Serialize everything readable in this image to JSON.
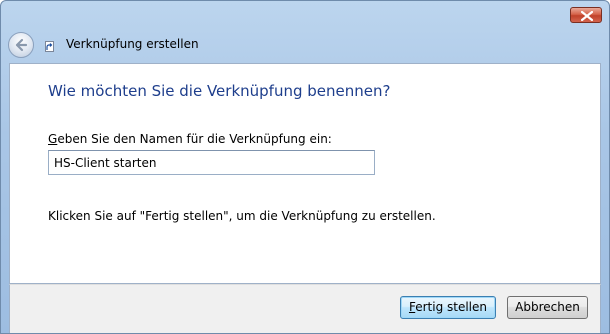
{
  "window": {
    "close_icon": "close-icon"
  },
  "nav": {
    "back_icon": "back-arrow-icon",
    "shortcut_icon": "shortcut-icon",
    "title": "Verknüpfung erstellen"
  },
  "content": {
    "heading": "Wie möchten Sie die Verknüpfung benennen?",
    "field_label_accesskey": "G",
    "field_label_rest": "eben Sie den Namen für die Verknüpfung ein:",
    "name_value": "HS-Client starten",
    "info_text": "Klicken Sie auf \"Fertig stellen\", um die Verknüpfung zu erstellen."
  },
  "footer": {
    "finish_accesskey": "F",
    "finish_rest": "ertig stellen",
    "cancel_label": "Abbrechen"
  }
}
